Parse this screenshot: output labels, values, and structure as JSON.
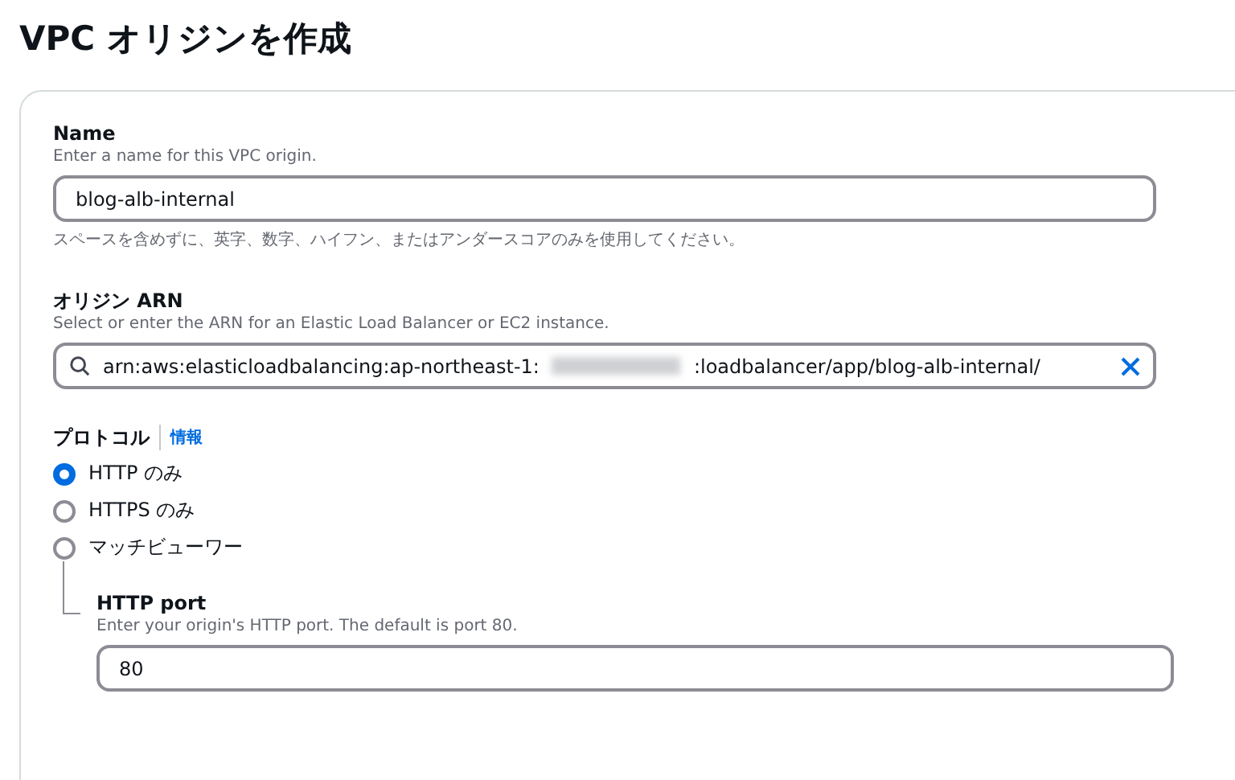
{
  "title": "VPC オリジンを作成",
  "name_field": {
    "label": "Name",
    "description": "Enter a name for this VPC origin.",
    "value": "blog-alb-internal",
    "constraint": "スペースを含めずに、英字、数字、ハイフン、またはアンダースコアのみを使用してください。"
  },
  "arn_field": {
    "label": "オリジン ARN",
    "description": "Select or enter the ARN for an Elastic Load Balancer or EC2 instance.",
    "value_start": "arn:aws:elasticloadbalancing:ap-northeast-1:",
    "value_end": ":loadbalancer/app/blog-alb-internal/"
  },
  "protocol": {
    "label": "プロトコル",
    "info_link": "情報",
    "options": [
      {
        "label": "HTTP のみ",
        "selected": true
      },
      {
        "label": "HTTPS のみ",
        "selected": false
      },
      {
        "label": "マッチビューワー",
        "selected": false
      }
    ]
  },
  "port_field": {
    "label": "HTTP port",
    "description": "Enter your origin's HTTP port. The default is port 80.",
    "value": "80"
  }
}
